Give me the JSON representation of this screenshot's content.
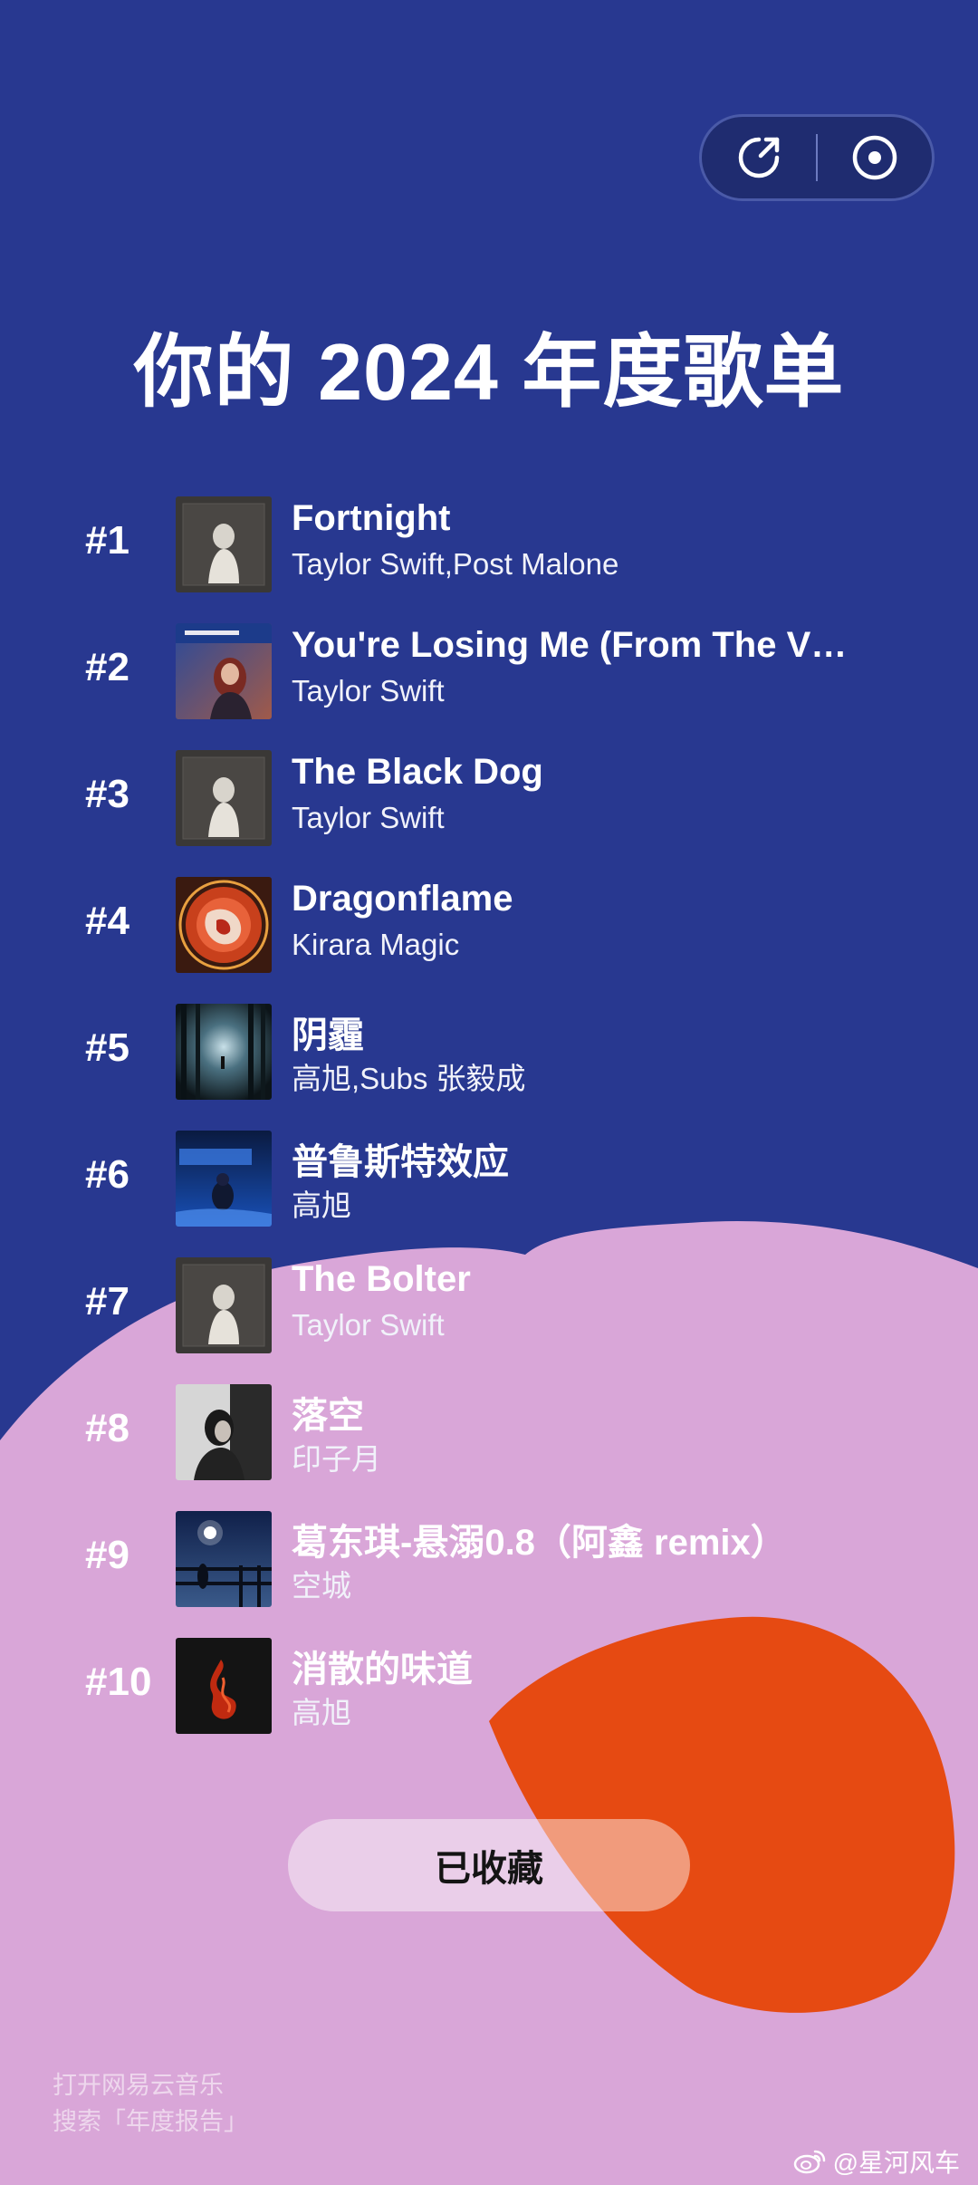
{
  "header": {
    "share_icon": "share-arrow-icon",
    "record_icon": "vinyl-icon"
  },
  "page": {
    "title": "你的 2024 年度歌单"
  },
  "songs": [
    {
      "rank": "#1",
      "title": "Fortnight",
      "artist": "Taylor Swift,Post Malone",
      "cover": "dark-portrait-cover"
    },
    {
      "rank": "#2",
      "title": "You're Losing Me (From The V…",
      "artist": "Taylor Swift",
      "cover": "red-portrait-cover"
    },
    {
      "rank": "#3",
      "title": "The Black Dog",
      "artist": "Taylor Swift",
      "cover": "dark-portrait-cover"
    },
    {
      "rank": "#4",
      "title": "Dragonflame",
      "artist": "Kirara Magic",
      "cover": "red-dragon-cover"
    },
    {
      "rank": "#5",
      "title": "阴霾",
      "artist": "高旭,Subs 张毅成",
      "cover": "forest-night-cover"
    },
    {
      "rank": "#6",
      "title": "普鲁斯特效应",
      "artist": "高旭",
      "cover": "blue-figure-cover"
    },
    {
      "rank": "#7",
      "title": "The Bolter",
      "artist": "Taylor Swift",
      "cover": "dark-portrait-cover"
    },
    {
      "rank": "#8",
      "title": "落空",
      "artist": "印子月",
      "cover": "bw-portrait-cover"
    },
    {
      "rank": "#9",
      "title": "葛东琪-悬溺0.8（阿鑫 remix）",
      "artist": "空城",
      "cover": "night-sky-cover"
    },
    {
      "rank": "#10",
      "title": "消散的味道",
      "artist": "高旭",
      "cover": "dark-fire-cover"
    }
  ],
  "actions": {
    "collect_label": "已收藏"
  },
  "footer": {
    "hint_line1": "打开网易云音乐",
    "hint_line2": "搜索「年度报告」",
    "watermark": "@星河风车"
  },
  "colors": {
    "background_blue": "#283890",
    "pink_blob": "#d9a6d8",
    "orange_blob": "#e64a12"
  }
}
